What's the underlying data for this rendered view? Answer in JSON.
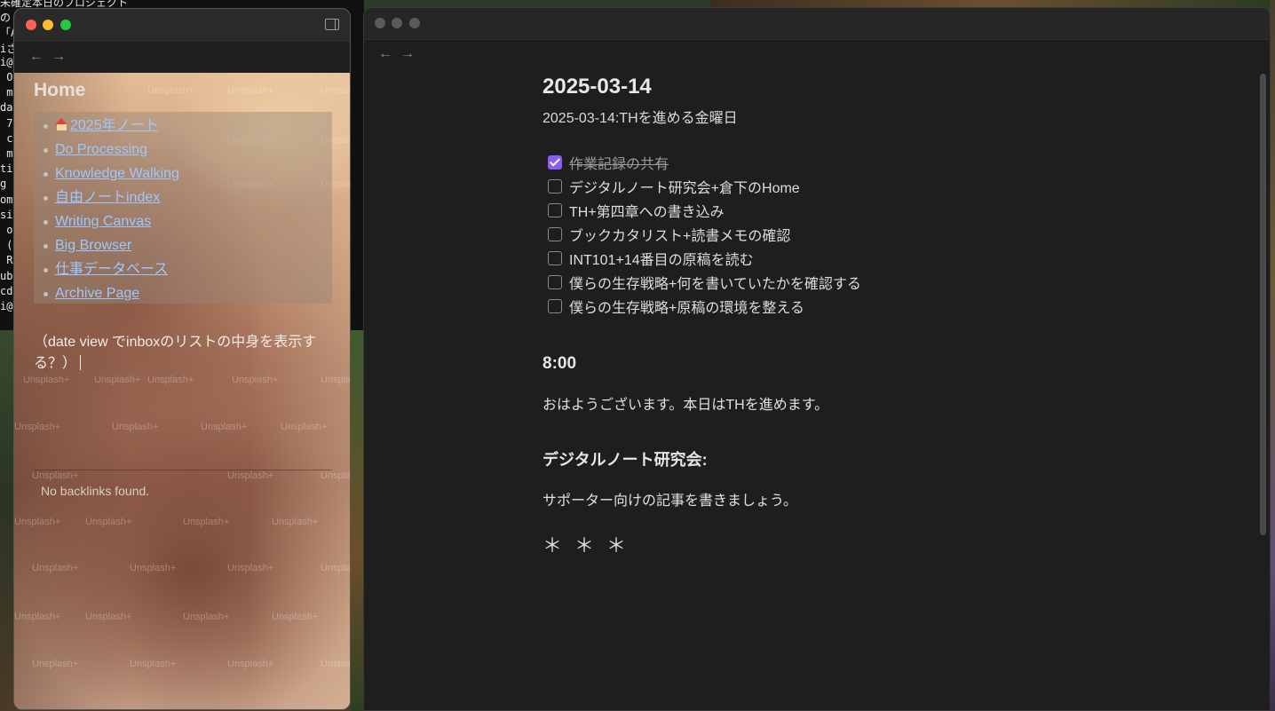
{
  "left_window": {
    "home_title": "Home",
    "links": [
      {
        "label": "2025年ノート",
        "icon": "house-icon"
      },
      {
        "label": "Do Processing"
      },
      {
        "label": "Knowledge Walking"
      },
      {
        "label": "自由ノートindex"
      },
      {
        "label": "Writing Canvas"
      },
      {
        "label": "Big Browser"
      },
      {
        "label": "仕事データベース"
      },
      {
        "label": "Archive Page"
      }
    ],
    "note_text": "（date view でinboxのリストの中身を表示する？）",
    "backlinks_text": "No backlinks found.",
    "watermark": "Unsplash+",
    "nav": {
      "back": "←",
      "forward": "→"
    }
  },
  "right_window": {
    "nav": {
      "back": "←",
      "forward": "→"
    },
    "title": "2025-03-14",
    "subtitle": "2025-03-14:THを進める金曜日",
    "tasks": [
      {
        "label": "作業記録の共有",
        "done": true
      },
      {
        "label": "デジタルノート研究会+倉下のHome",
        "done": false
      },
      {
        "label": "TH+第四章への書き込み",
        "done": false
      },
      {
        "label": "ブックカタリスト+読書メモの確認",
        "done": false
      },
      {
        "label": "INT101+14番目の原稿を読む",
        "done": false
      },
      {
        "label": "僕らの生存戦略+何を書いていたかを確認する",
        "done": false
      },
      {
        "label": "僕らの生存戦略+原稿の環境を整える",
        "done": false
      }
    ],
    "section1_heading": "8:00",
    "section1_text": "おはようございます。本日はTHを進めます。",
    "section2_heading": "デジタルノート研究会:",
    "section2_text": "サポーター向けの記事を書きましょう。",
    "separator": "＊＊＊"
  },
  "terminal_fragment": {
    "lines": [
      "未確定本日のプロジェクト",
      "の",
      "「A",
      "iさ",
      "i@",
      " O",
      " m",
      "da",
      " 7",
      " c",
      " m",
      "ti",
      "g",
      "om",
      "si",
      " o",
      " (",
      " R",
      "ub",
      "cd",
      "i@"
    ]
  },
  "colors": {
    "link": "#9fc7ff",
    "checkbox_checked": "#8b5cf6",
    "editor_bg": "#1e1e1e"
  }
}
